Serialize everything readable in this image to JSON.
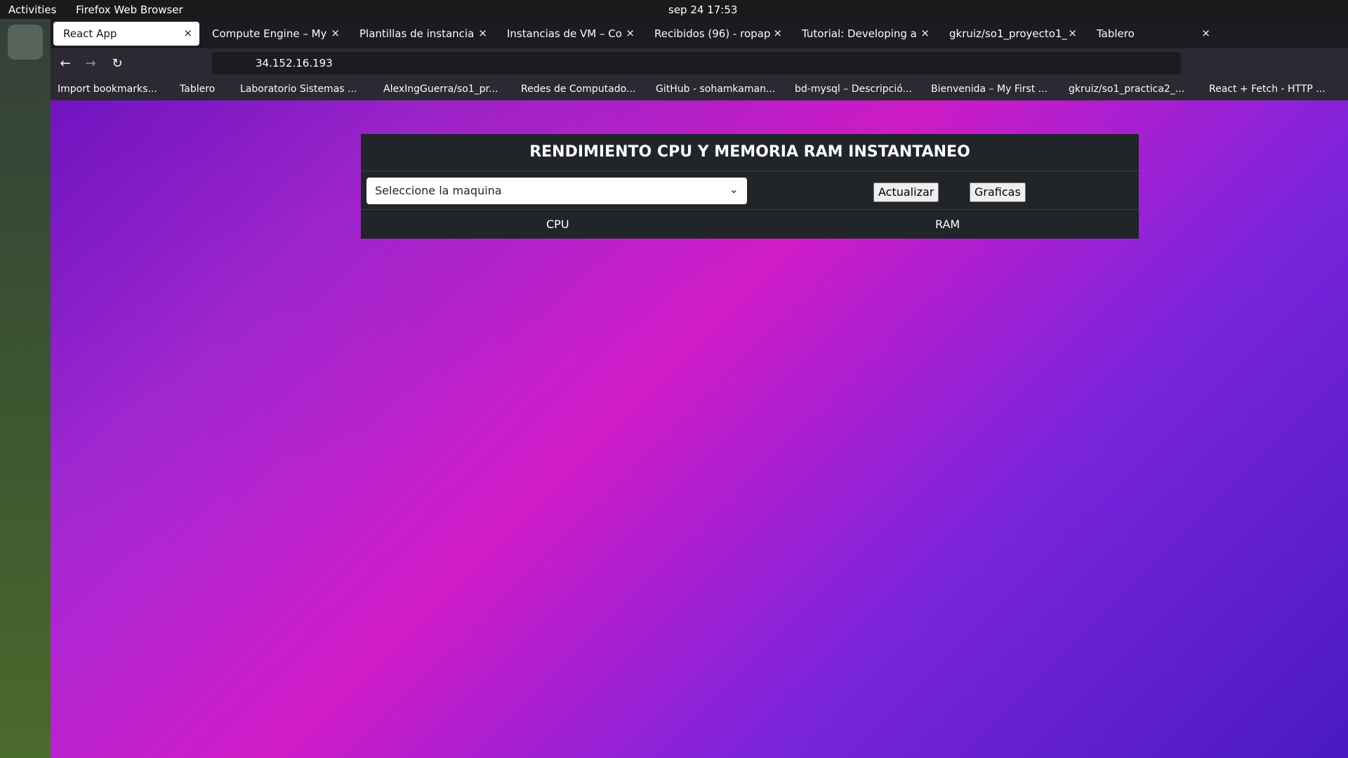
{
  "topbar": {
    "activities": "Activities",
    "app": "Firefox Web Browser",
    "clock": "sep 24  17:53"
  },
  "tabs": [
    {
      "title": "React App",
      "active": true
    },
    {
      "title": "Compute Engine – My",
      "active": false
    },
    {
      "title": "Plantillas de instancia",
      "active": false
    },
    {
      "title": "Instancias de VM – Co",
      "active": false
    },
    {
      "title": "Recibidos (96) - ropap",
      "active": false
    },
    {
      "title": "Tutorial: Developing a",
      "active": false
    },
    {
      "title": "gkruiz/so1_proyecto1_",
      "active": false
    },
    {
      "title": "Tablero",
      "active": false
    }
  ],
  "url": "34.152.16.193",
  "bookmarks": [
    "Import bookmarks...",
    "Tablero",
    "Laboratorio Sistemas ...",
    "AlexIngGuerra/so1_pr...",
    "Redes de Computado...",
    "GitHub - sohamkaman...",
    "bd-mysql – Descripció...",
    "Bienvenida – My First ...",
    "gkruiz/so1_practica2_...",
    "React + Fetch - HTTP ..."
  ],
  "panel": {
    "title": "RENDIMIENTO CPU Y MEMORIA RAM INSTANTANEO",
    "select_value": "Seleccione la maquina",
    "update_label": "Actualizar",
    "graphs_label": "Graficas",
    "cpu_label": "CPU",
    "ram_label": "RAM"
  }
}
